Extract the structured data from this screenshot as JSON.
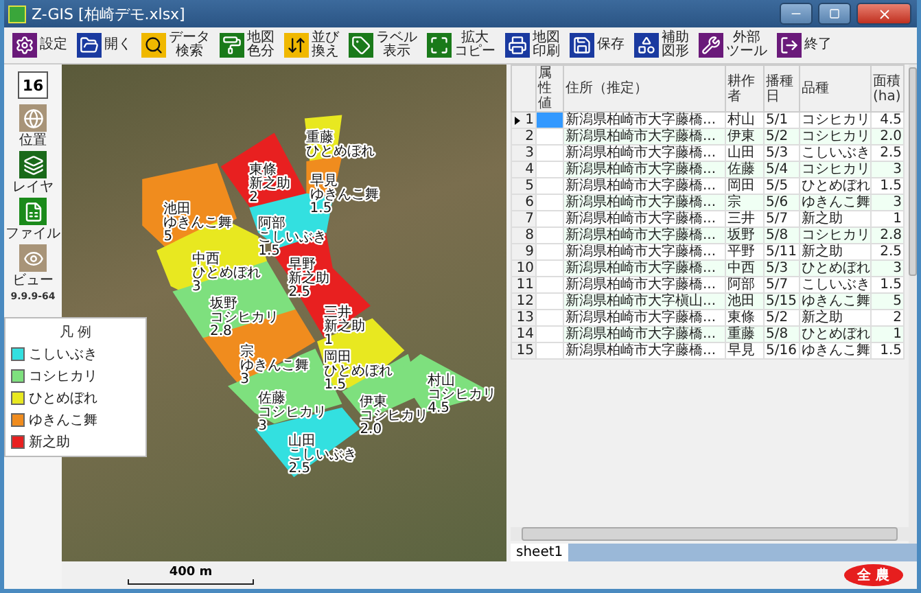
{
  "window": {
    "title": "Z-GIS [柏崎デモ.xlsx]"
  },
  "toolbar": [
    {
      "lines": [
        "設定"
      ]
    },
    {
      "lines": [
        "開く"
      ]
    },
    {
      "lines": [
        "データ",
        "検索"
      ]
    },
    {
      "lines": [
        "地図",
        "色分"
      ]
    },
    {
      "lines": [
        "並び",
        "換え"
      ]
    },
    {
      "lines": [
        "ラベル",
        "表示"
      ]
    },
    {
      "lines": [
        "拡大",
        "コピー"
      ]
    },
    {
      "lines": [
        "地図",
        "印刷"
      ]
    },
    {
      "lines": [
        "保存"
      ]
    },
    {
      "lines": [
        "補助",
        "図形"
      ]
    },
    {
      "lines": [
        "外部",
        "ツール"
      ]
    },
    {
      "lines": [
        "終了"
      ]
    }
  ],
  "side_panel": {
    "zoom_level": "16",
    "items": [
      {
        "label": "位置"
      },
      {
        "label": "レイヤ"
      },
      {
        "label": "ファイル"
      },
      {
        "label": "ビュー"
      }
    ],
    "version": "9.9.9-64"
  },
  "legend": {
    "title": "凡 例",
    "items": [
      {
        "label": "こしいぶき",
        "color": "#33e0e0"
      },
      {
        "label": "コシヒカリ",
        "color": "#7ee07e"
      },
      {
        "label": "ひとめぼれ",
        "color": "#e8e820"
      },
      {
        "label": "ゆきんこ舞",
        "color": "#f08c1e"
      },
      {
        "label": "新之助",
        "color": "#e82020"
      }
    ]
  },
  "map": {
    "parcels": [
      {
        "lines": [
          "重藤",
          "ひとめぼれ"
        ],
        "color": "#e8e820"
      },
      {
        "lines": [
          "東條",
          "新之助",
          "2"
        ],
        "color": "#e82020"
      },
      {
        "lines": [
          "早見",
          "ゆきんこ舞",
          "1.5"
        ],
        "color": "#f08c1e"
      },
      {
        "lines": [
          "阿部",
          "こしいぶき",
          "1.5"
        ],
        "color": "#33e0e0"
      },
      {
        "lines": [
          "池田",
          "ゆきんこ舞",
          "5"
        ],
        "color": "#f08c1e"
      },
      {
        "lines": [
          "中西",
          "ひとめぼれ",
          "3"
        ],
        "color": "#e8e820"
      },
      {
        "lines": [
          "早野",
          "新之助",
          "2.5"
        ],
        "color": "#e82020"
      },
      {
        "lines": [
          "坂野",
          "コシヒカリ",
          "2.8"
        ],
        "color": "#7ee07e"
      },
      {
        "lines": [
          "三井",
          "新之助",
          "1"
        ],
        "color": "#e82020"
      },
      {
        "lines": [
          "宗",
          "ゆきんこ舞",
          "3"
        ],
        "color": "#f08c1e"
      },
      {
        "lines": [
          "岡田",
          "ひとめぼれ",
          "1.5"
        ],
        "color": "#e8e820"
      },
      {
        "lines": [
          "佐藤",
          "コシヒカリ",
          "3"
        ],
        "color": "#7ee07e"
      },
      {
        "lines": [
          "伊東",
          "コシヒカリ",
          "2.0"
        ],
        "color": "#7ee07e"
      },
      {
        "lines": [
          "村山",
          "コシヒカリ",
          "4.5"
        ],
        "color": "#7ee07e"
      },
      {
        "lines": [
          "山田",
          "こしいぶき",
          "2.5"
        ],
        "color": "#33e0e0"
      }
    ],
    "scale": "400 m"
  },
  "table": {
    "columns": [
      "属性値",
      "住所（推定）",
      "耕作者",
      "播種日",
      "品種",
      "面積(ha)"
    ],
    "rows": [
      {
        "no": "1",
        "cells": [
          "",
          "新潟県柏崎市大字藤橋...",
          "村山",
          "5/1",
          "コシヒカリ",
          "4.5"
        ],
        "selected": true
      },
      {
        "no": "2",
        "cells": [
          "",
          "新潟県柏崎市大字藤橋...",
          "伊東",
          "5/2",
          "コシヒカリ",
          "2.0"
        ],
        "selected": false
      },
      {
        "no": "3",
        "cells": [
          "",
          "新潟県柏崎市大字藤橋...",
          "山田",
          "5/3",
          "こしいぶき",
          "2.5"
        ],
        "selected": false
      },
      {
        "no": "4",
        "cells": [
          "",
          "新潟県柏崎市大字藤橋...",
          "佐藤",
          "5/4",
          "コシヒカリ",
          "3"
        ],
        "selected": false
      },
      {
        "no": "5",
        "cells": [
          "",
          "新潟県柏崎市大字藤橋...",
          "岡田",
          "5/5",
          "ひとめぼれ",
          "1.5"
        ],
        "selected": false
      },
      {
        "no": "6",
        "cells": [
          "",
          "新潟県柏崎市大字藤橋...",
          "宗",
          "5/6",
          "ゆきんこ舞",
          "3"
        ],
        "selected": false
      },
      {
        "no": "7",
        "cells": [
          "",
          "新潟県柏崎市大字藤橋...",
          "三井",
          "5/7",
          "新之助",
          "1"
        ],
        "selected": false
      },
      {
        "no": "8",
        "cells": [
          "",
          "新潟県柏崎市大字藤橋...",
          "坂野",
          "5/8",
          "コシヒカリ",
          "2.8"
        ],
        "selected": false
      },
      {
        "no": "9",
        "cells": [
          "",
          "新潟県柏崎市大字藤橋...",
          "平野",
          "5/11",
          "新之助",
          "2.5"
        ],
        "selected": false
      },
      {
        "no": "10",
        "cells": [
          "",
          "新潟県柏崎市大字藤橋...",
          "中西",
          "5/3",
          "ひとめぼれ",
          "3"
        ],
        "selected": false
      },
      {
        "no": "11",
        "cells": [
          "",
          "新潟県柏崎市大字藤橋...",
          "阿部",
          "5/7",
          "こしいぶき",
          "1.5"
        ],
        "selected": false
      },
      {
        "no": "12",
        "cells": [
          "",
          "新潟県柏崎市大字槇山...",
          "池田",
          "5/15",
          "ゆきんこ舞",
          "5"
        ],
        "selected": false
      },
      {
        "no": "13",
        "cells": [
          "",
          "新潟県柏崎市大字藤橋...",
          "東條",
          "5/2",
          "新之助",
          "2"
        ],
        "selected": false
      },
      {
        "no": "14",
        "cells": [
          "",
          "新潟県柏崎市大字藤橋...",
          "重藤",
          "5/8",
          "ひとめぼれ",
          "1"
        ],
        "selected": false
      },
      {
        "no": "15",
        "cells": [
          "",
          "新潟県柏崎市大字藤橋...",
          "早見",
          "5/16",
          "ゆきんこ舞",
          "1.5"
        ],
        "selected": false
      }
    ]
  },
  "sheet_tabs": [
    {
      "label": "sheet1",
      "selected": true
    }
  ],
  "logo": {
    "text": "全 農"
  }
}
